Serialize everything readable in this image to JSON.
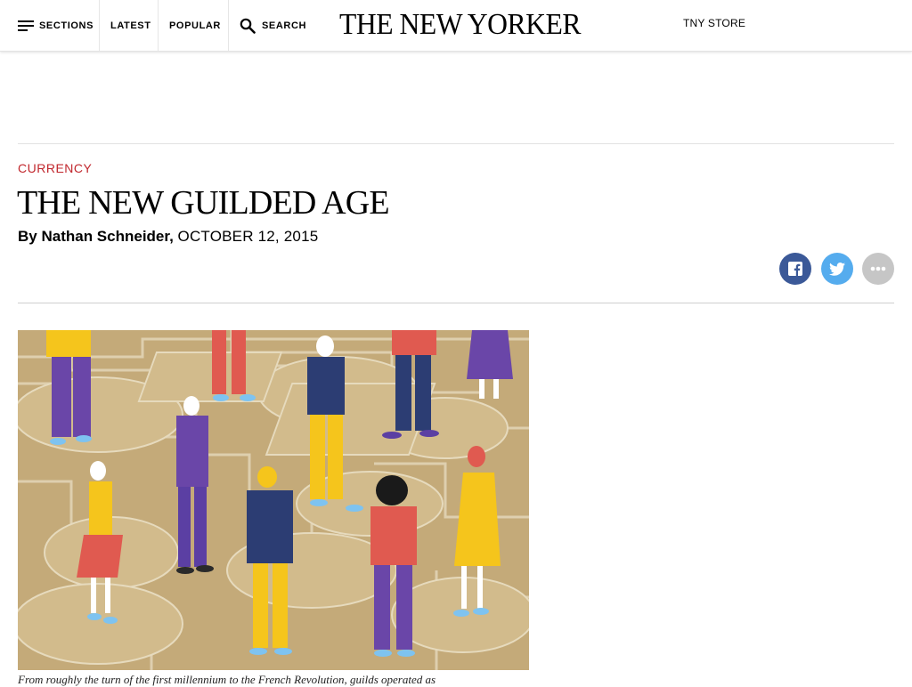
{
  "nav": {
    "sections_label": "SECTIONS",
    "latest_label": "LATEST",
    "popular_label": "POPULAR",
    "search_label": "SEARCH",
    "logo_text": "THE NEW YORKER",
    "store_label": "TNY STORE"
  },
  "article": {
    "rubric": "CURRENCY",
    "headline": "THE NEW GUILDED AGE",
    "byline_prefix": "By",
    "author": "Nathan Schneider,",
    "date": "OCTOBER 12, 2015",
    "caption": "From roughly the turn of the first millennium to the French Revolution, guilds operated as"
  },
  "share": {
    "facebook_icon": "facebook-icon",
    "twitter_icon": "twitter-icon",
    "more_icon": "more-options-icon"
  },
  "colors": {
    "rubric": "#c1272d",
    "facebook": "#3b5998",
    "twitter": "#55acee",
    "more": "#c6c6c6",
    "illustration_bg": "#c4aa79"
  }
}
